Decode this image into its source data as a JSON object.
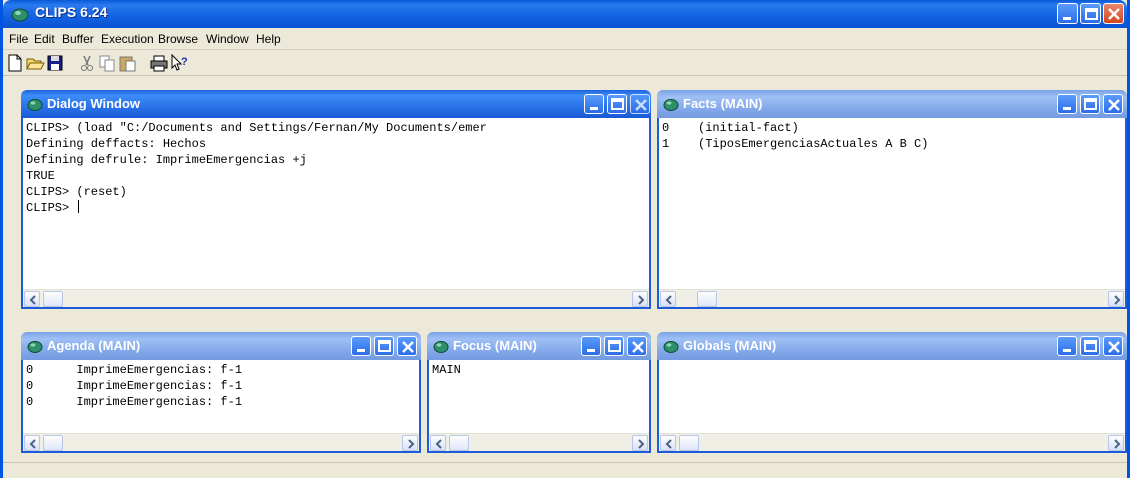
{
  "app": {
    "title": "CLIPS 6.24"
  },
  "menu": [
    "File",
    "Edit",
    "Buffer",
    "Execution",
    "Browse",
    "Window",
    "Help"
  ],
  "toolbar": {
    "tools": [
      "new-file-icon",
      "open-folder-icon",
      "save-disk-icon",
      "cut-scissors-icon",
      "copy-icon",
      "paste-icon",
      "print-icon",
      "help-pointer-icon"
    ]
  },
  "windows": {
    "dialog": {
      "title": "Dialog Window",
      "lines": [
        "CLIPS> (load \"C:/Documents and Settings/Fernan/My Documents/emer",
        "Defining deffacts: Hechos",
        "Defining defrule: ImprimeEmergencias +j",
        "TRUE",
        "CLIPS> (reset)",
        "CLIPS> "
      ]
    },
    "facts": {
      "title": "Facts (MAIN)",
      "lines": [
        "0    (initial-fact)",
        "1    (TiposEmergenciasActuales A B C)"
      ]
    },
    "agenda": {
      "title": "Agenda (MAIN)",
      "lines": [
        "0      ImprimeEmergencias: f-1",
        "0      ImprimeEmergencias: f-1",
        "0      ImprimeEmergencias: f-1"
      ]
    },
    "focus": {
      "title": "Focus (MAIN)",
      "lines": [
        "MAIN"
      ]
    },
    "globals": {
      "title": "Globals (MAIN)",
      "lines": []
    }
  },
  "colors": {
    "title_blue": "#1464e4",
    "close_red": "#d5451c",
    "face": "#ece9d8"
  }
}
